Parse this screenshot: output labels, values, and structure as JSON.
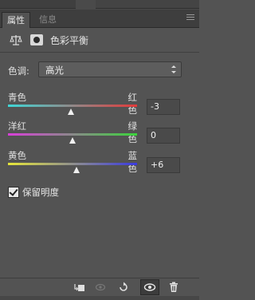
{
  "panel": {
    "tabs": [
      {
        "label": "属性"
      },
      {
        "label": "信息"
      }
    ],
    "title": "色彩平衡"
  },
  "tone": {
    "label": "色调:",
    "selected": "高光"
  },
  "sliders": [
    {
      "left_label": "青色",
      "right_label": "红色",
      "value": "-3",
      "gradient": [
        "#3fd6d6",
        "#e23a3a"
      ],
      "level": -3
    },
    {
      "left_label": "洋红",
      "right_label": "绿色",
      "value": "0",
      "gradient": [
        "#d93fd9",
        "#3bd43b"
      ],
      "level": 0
    },
    {
      "left_label": "黄色",
      "right_label": "蓝色",
      "value": "+6",
      "gradient": [
        "#e6e63a",
        "#3a3ae0"
      ],
      "level": 6
    }
  ],
  "preserve": {
    "label": "保留明度",
    "checked": true
  },
  "icons": {
    "balance": "balance-icon",
    "mask": "mask-icon",
    "clip": "clip-to-layer-icon",
    "view_previous": "view-previous-state-icon",
    "reset": "reset-icon",
    "visibility": "eye-icon",
    "delete": "trash-icon"
  }
}
